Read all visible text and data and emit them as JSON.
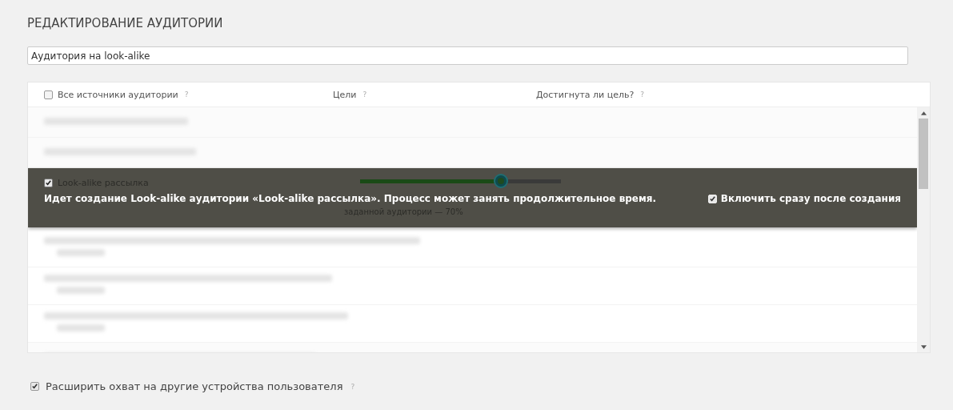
{
  "title": "РЕДАКТИРОВАНИЕ АУДИТОРИИ",
  "name_field": {
    "value": "Аудитория на look-alike"
  },
  "table": {
    "select_all": {
      "checked": false
    },
    "columns": [
      {
        "label": "Все источники аудитории",
        "help": "?"
      },
      {
        "label": "Цели",
        "help": "?"
      },
      {
        "label": "Достигнута ли цель?",
        "help": "?"
      }
    ],
    "blurred_before": [
      {
        "kind": "single"
      },
      {
        "kind": "single"
      }
    ],
    "active_row": {
      "label": "Look-alike рассылка",
      "checked": true,
      "level": 0.7,
      "reading": "заданной аудитории — 70%"
    },
    "blurred_after": [
      {
        "kind": "double"
      },
      {
        "kind": "double"
      },
      {
        "kind": "double"
      },
      {
        "kind": "single"
      }
    ]
  },
  "notice": {
    "message": "Идет создание Look-alike аудитории «Look-alike рассылка». Процесс может занять продолжительное время.",
    "option": {
      "label": "Включить сразу после создания",
      "checked": true
    }
  },
  "extend": {
    "label": "Расширить охват на другие устройства пользователя",
    "help": "?",
    "checked": true
  }
}
